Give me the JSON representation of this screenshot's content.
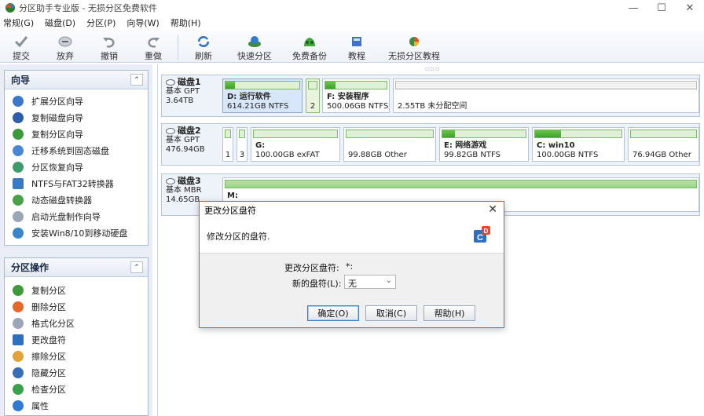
{
  "window": {
    "title": "分区助手专业版 - 无损分区免费软件",
    "controls": {
      "minimize": "—",
      "maximize": "☐",
      "close": "✕"
    }
  },
  "menu": [
    "常规(G)",
    "磁盘(D)",
    "分区(P)",
    "向导(W)",
    "帮助(H)"
  ],
  "toolbar": {
    "submit": "提交",
    "discard": "放弃",
    "undo": "撤销",
    "redo": "重做",
    "refresh": "刷新",
    "quick_partition": "快速分区",
    "free_backup": "免费备份",
    "tutorial": "教程",
    "lossless_tutorial": "无损分区教程"
  },
  "wizard_panel": {
    "title": "向导",
    "items": [
      "扩展分区向导",
      "复制磁盘向导",
      "复制分区向导",
      "迁移系统到固态磁盘",
      "分区恢复向导",
      "NTFS与FAT32转换器",
      "动态磁盘转换器",
      "启动光盘制作向导",
      "安装Win8/10到移动硬盘"
    ]
  },
  "ops_panel": {
    "title": "分区操作",
    "items": [
      "复制分区",
      "删除分区",
      "格式化分区",
      "更改盘符",
      "擦除分区",
      "隐藏分区",
      "检查分区",
      "属性"
    ]
  },
  "disks": [
    {
      "name": "磁盘1",
      "type": "基本 GPT",
      "size": "3.64TB",
      "parts": [
        {
          "label": "D: 运行软件",
          "detail": "614.21GB NTFS",
          "used": 0.13
        },
        {
          "label": "",
          "detail": "2",
          "used": 0
        },
        {
          "label": "F: 安装程序",
          "detail": "500.06GB NTFS",
          "used": 0.17
        },
        {
          "label": "",
          "detail": "2.55TB 未分配空间",
          "used": 0
        }
      ]
    },
    {
      "name": "磁盘2",
      "type": "基本 GPT",
      "size": "476.94GB",
      "parts": [
        {
          "label": "",
          "detail": "1",
          "used": 0
        },
        {
          "label": "",
          "detail": "3",
          "used": 0
        },
        {
          "label": "G:",
          "detail": "100.00GB exFAT",
          "used": 0
        },
        {
          "label": "",
          "detail": "99.88GB Other",
          "used": 0
        },
        {
          "label": "E: 网络游戏",
          "detail": "99.82GB NTFS",
          "used": 0.15
        },
        {
          "label": "C: win10",
          "detail": "100.00GB NTFS",
          "used": 0.3
        },
        {
          "label": "",
          "detail": "76.94GB Other",
          "used": 0
        }
      ]
    },
    {
      "name": "磁盘3",
      "type": "基本 MBR",
      "size": "14.65GB",
      "parts": [
        {
          "label": "M:",
          "detail": "",
          "used": 1.0
        }
      ]
    }
  ],
  "dialog": {
    "title": "更改分区盘符",
    "description": "修改分区的盘符.",
    "current_label": "更改分区盘符:",
    "current_value": "*:",
    "new_label": "新的盘符(L):",
    "new_value": "无",
    "ok": "确定(O)",
    "cancel": "取消(C)",
    "help": "帮助(H)"
  },
  "colors": {
    "accent": "#3c86c8",
    "used_bar": "#3ea22a",
    "panel_bg": "#e9eef6"
  }
}
